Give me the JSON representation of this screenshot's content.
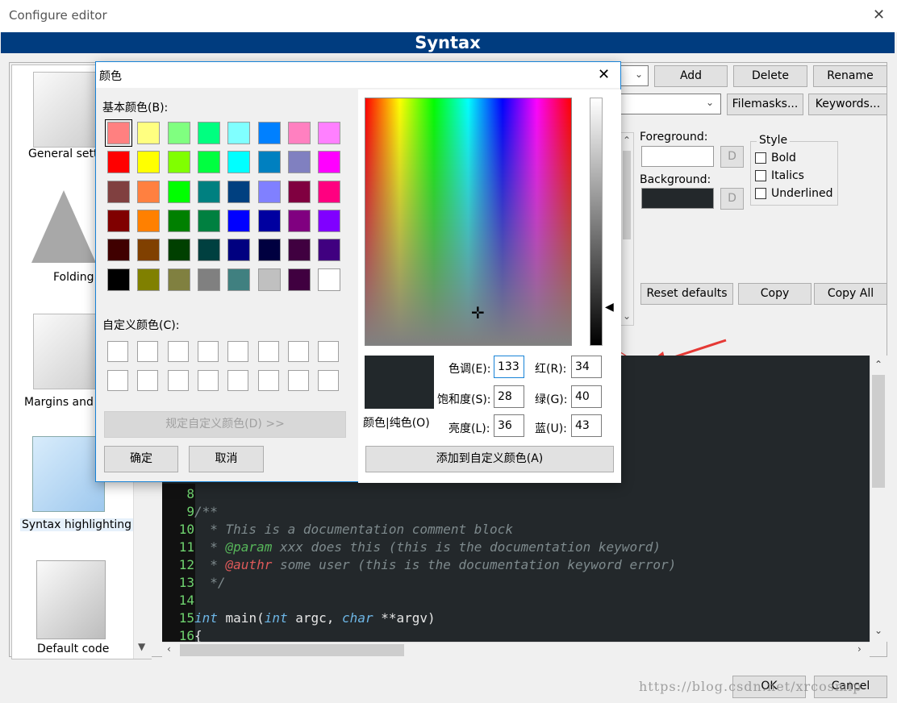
{
  "window": {
    "title": "Configure editor",
    "close": "✕"
  },
  "header": {
    "title": "Syntax"
  },
  "sidebar": {
    "items": [
      {
        "label": "General sett"
      },
      {
        "label": "Folding"
      },
      {
        "label": "Margins and c"
      },
      {
        "label": "Syntax highlighting"
      },
      {
        "label": "Default code"
      }
    ]
  },
  "toolbar": {
    "add": "Add",
    "delete": "Delete",
    "rename": "Rename",
    "filemasks": "Filemasks...",
    "keywords": "Keywords..."
  },
  "style_panel": {
    "foreground_label": "Foreground:",
    "background_label": "Background:",
    "d_button": "D",
    "style_title": "Style",
    "bold": "Bold",
    "italics": "Italics",
    "underlined": "Underlined",
    "reset_defaults": "Reset defaults",
    "copy": "Copy",
    "copy_all": "Copy All",
    "background_color": "#23282b"
  },
  "code": {
    "lines": [
      {
        "n": "8"
      },
      {
        "n": "9",
        "a": "/**"
      },
      {
        "n": "10",
        "a": "  * This is a documentation comment block"
      },
      {
        "n": "11",
        "a": "  * ",
        "b": "@param",
        "c": " xxx does this (this is the documentation keyword)"
      },
      {
        "n": "12",
        "a": "  * ",
        "b": "@authr",
        "c": " some user (this is the documentation keyword error)"
      },
      {
        "n": "13",
        "a": "  */"
      },
      {
        "n": "14"
      },
      {
        "n": "15",
        "k1": "int",
        "t1": " main(",
        "k2": "int",
        "t2": " argc, ",
        "k3": "char",
        "t3": " **argv)"
      },
      {
        "n": "16",
        "t1": "{"
      }
    ]
  },
  "footer": {
    "ok": "OK",
    "cancel": "Cancel"
  },
  "watermark": "https://blog.csdn.net/xrcosmip",
  "color_dialog": {
    "title": "颜色",
    "close": "✕",
    "basic_label": "基本颜色(B):",
    "custom_label": "自定义颜色(C):",
    "define_custom": "规定自定义颜色(D) >>",
    "ok": "确定",
    "cancel": "取消",
    "color_solid": "颜色|纯色(O)",
    "hue_label": "色调(E):",
    "hue": "133",
    "sat_label": "饱和度(S):",
    "sat": "28",
    "lum_label": "亮度(L):",
    "lum": "36",
    "red_label": "红(R):",
    "red": "34",
    "green_label": "绿(G):",
    "green": "40",
    "blue_label": "蓝(U):",
    "blue": "43",
    "add_custom": "添加到自定义颜色(A)",
    "selected_color": "#22282b",
    "basic_colors": [
      "#ff8080",
      "#ffff80",
      "#80ff80",
      "#00ff80",
      "#80ffff",
      "#0080ff",
      "#ff80c0",
      "#ff80ff",
      "#ff0000",
      "#ffff00",
      "#80ff00",
      "#00ff40",
      "#00ffff",
      "#0080c0",
      "#8080c0",
      "#ff00ff",
      "#804040",
      "#ff8040",
      "#00ff00",
      "#008080",
      "#004080",
      "#8080ff",
      "#800040",
      "#ff0080",
      "#800000",
      "#ff8000",
      "#008000",
      "#008040",
      "#0000ff",
      "#0000a0",
      "#800080",
      "#8000ff",
      "#400000",
      "#804000",
      "#004000",
      "#004040",
      "#000080",
      "#000040",
      "#400040",
      "#400080",
      "#000000",
      "#808000",
      "#808040",
      "#808080",
      "#408080",
      "#c0c0c0",
      "#400040",
      "#ffffff"
    ]
  }
}
